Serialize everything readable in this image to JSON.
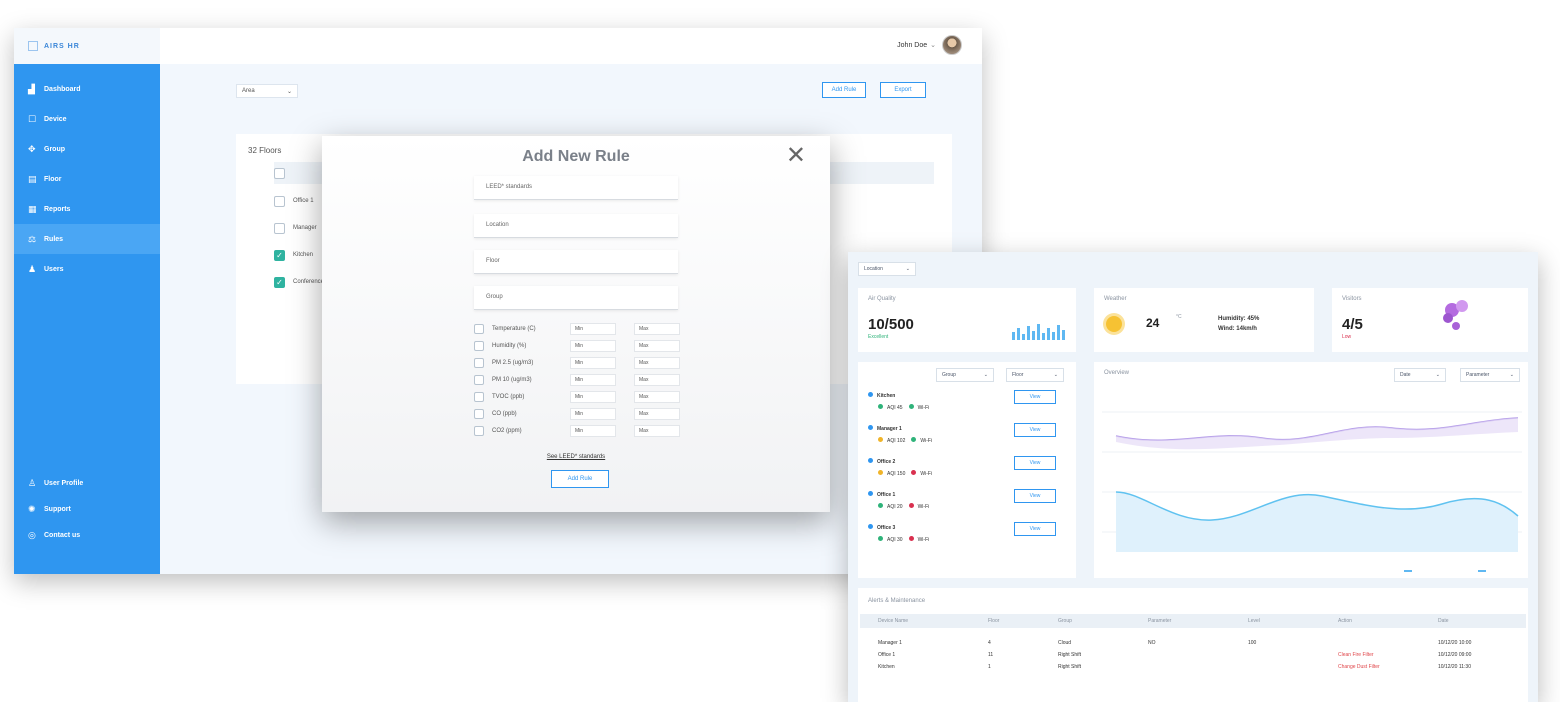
{
  "back_window": {
    "brand": "AIRS HR",
    "sidebar": [
      {
        "icon": "chart-icon",
        "label": "Dashboard"
      },
      {
        "icon": "device-icon",
        "label": "Device"
      },
      {
        "icon": "group-icon",
        "label": "Group"
      },
      {
        "icon": "floor-icon",
        "label": "Floor"
      },
      {
        "icon": "reports-icon",
        "label": "Reports"
      },
      {
        "icon": "rules-icon",
        "label": "Rules"
      },
      {
        "icon": "users-icon",
        "label": "Users"
      }
    ],
    "sidebar_bottom": [
      {
        "icon": "profile-icon",
        "label": "User Profile"
      },
      {
        "icon": "support-icon",
        "label": "Support"
      },
      {
        "icon": "contact-icon",
        "label": "Contact us"
      }
    ],
    "user_name": "John Doe",
    "filter_value": "Area",
    "add_rule_label": "Add Rule",
    "export_label": "Export",
    "floors_title": "32 Floors",
    "rows": [
      {
        "label": "Office 1",
        "checked": false
      },
      {
        "label": "Manager",
        "checked": false
      },
      {
        "label": "Kitchen",
        "checked": true
      },
      {
        "label": "Conference",
        "checked": true
      }
    ]
  },
  "modal": {
    "title": "Add New Rule",
    "fields": [
      "LEED* standards",
      "Location",
      "Floor",
      "Group"
    ],
    "params": [
      "Temperature (C)",
      "Humidity (%)",
      "PM 2.5 (ug/m3)",
      "PM 10 (ug/m3)",
      "TVOC (ppb)",
      "CO (ppb)",
      "CO2 (ppm)"
    ],
    "min_label": "Min",
    "max_label": "Max",
    "see_link": "See LEED* standards",
    "add_button": "Add Rule"
  },
  "front_window": {
    "location": "Location",
    "air_quality": {
      "label": "Air Quality",
      "value": "10/500",
      "status": "Excellent"
    },
    "weather": {
      "label": "Weather",
      "temp": "24",
      "unit": "°C",
      "humidity": "Humidity: 45%",
      "wind": "Wind: 14km/h"
    },
    "visitors": {
      "label": "Visitors",
      "value": "4/5",
      "status": "Low"
    },
    "group_sel": "Group",
    "floor_sel": "Floor",
    "date_sel": "Date",
    "param_sel": "Parameter",
    "chart_label": "Overview",
    "locations": [
      {
        "name": "Kitchen",
        "aq": "AQI 45",
        "wifi": "Wi-Fi",
        "c1": "#2fb37a",
        "c2": "#2fb37a"
      },
      {
        "name": "Manager 1",
        "aq": "AQI 102",
        "wifi": "Wi-Fi",
        "c1": "#f0b429",
        "c2": "#2fb37a"
      },
      {
        "name": "Office 2",
        "aq": "AQI 150",
        "wifi": "Wi-Fi",
        "c1": "#f0b429",
        "c2": "#d9304f"
      },
      {
        "name": "Office 1",
        "aq": "AQI 20",
        "wifi": "Wi-Fi",
        "c1": "#2fb37a",
        "c2": "#d9304f"
      },
      {
        "name": "Office 3",
        "aq": "AQI 30",
        "wifi": "Wi-Fi",
        "c1": "#2fb37a",
        "c2": "#d9304f"
      }
    ],
    "view_label": "View",
    "table_title": "Alerts & Maintenance",
    "table_headers": [
      "Device Name",
      "Floor",
      "Group",
      "Parameter",
      "Level",
      "Action",
      "Date"
    ],
    "table_rows": [
      [
        "Manager 1",
        "4",
        "Cloud",
        "NO",
        "100",
        "",
        "10/12/20 10:00"
      ],
      [
        "Office 1",
        "11",
        "Right Shift",
        "",
        "",
        "Clean Fire Filter",
        "10/12/20 09:00"
      ],
      [
        "Kitchen",
        "1",
        "Right Shift",
        "",
        "",
        "Change Dust Filter",
        "10/12/20 11:30"
      ]
    ]
  }
}
